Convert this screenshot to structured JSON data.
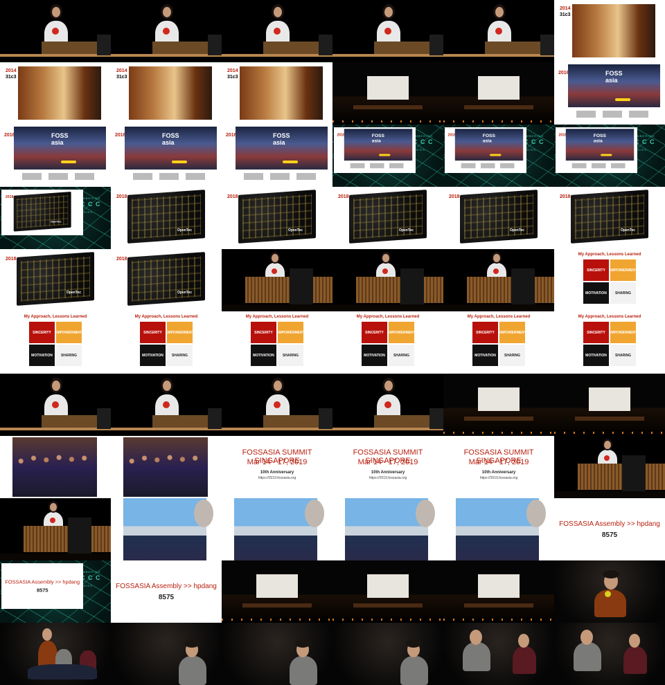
{
  "frames": {
    "year_2014": "2014",
    "congress_31c3": "31c3",
    "year_2016": "2016",
    "year_2018": "2018",
    "foss_logo_line1": "FOSS",
    "foss_logo_line2": "asia",
    "remembering": "REMEMBERING",
    "ccc_logo": "✦ C C C",
    "memories": "MEMORIES",
    "approach_title": "My Approach, Lessons Learned",
    "sincerity": "SINCERITY",
    "empowerment": "EMPOWERMENT",
    "motivation": "MOTIVATION",
    "sharing": "SHARING",
    "board_label": "OpenTec",
    "summit_title": "FOSSASIA SUMMIT SINGAPORE",
    "summit_dates": "Mar 14 - 17, 2019",
    "summit_anniversary": "10th Anniversary",
    "summit_url": "https://2019.fossasia.org",
    "assembly_title": "FOSSASIA Assembly >> hpdang",
    "assembly_code": "8575"
  },
  "colors": {
    "accent_red": "#b8200f",
    "sincerity": "#b8110c",
    "empowerment": "#f0a530",
    "motivation": "#111111",
    "sharing": "#f2f2f2",
    "teal": "#3fc7b0"
  }
}
